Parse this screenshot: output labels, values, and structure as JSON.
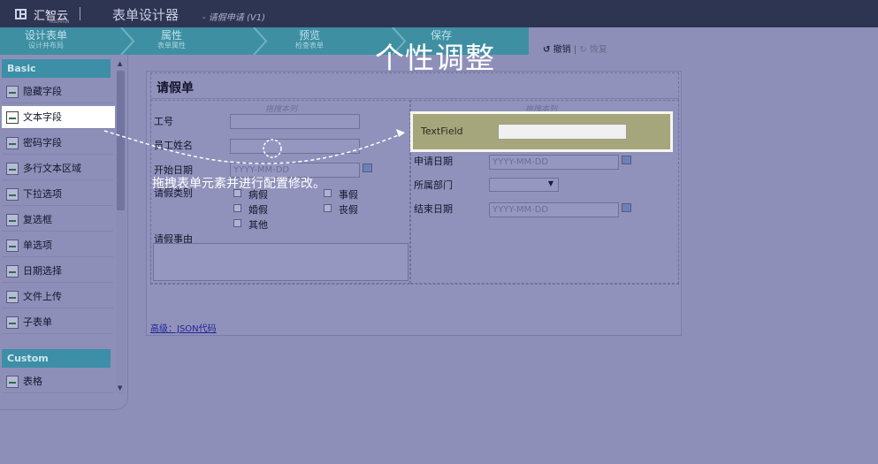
{
  "header": {
    "brand": "汇智云",
    "brand_sub": "HUIZHIYUN",
    "title": "表单设计器",
    "subtitle": "- 请假申请 (V1)"
  },
  "steps": [
    {
      "title": "设计表单",
      "sub": "设计并布局"
    },
    {
      "title": "属性",
      "sub": "表单属性"
    },
    {
      "title": "预览",
      "sub": "检查表单"
    },
    {
      "title": "保存",
      "sub": ""
    }
  ],
  "toolbar": {
    "undo_label": "撤销",
    "redo_label": "恢复"
  },
  "overlay": {
    "title": "个性调整",
    "hint": "拖拽表单元素并进行配置修改。"
  },
  "sidebar": {
    "basic_label": "Basic",
    "custom_label": "Custom",
    "basic_items": [
      "隐藏字段",
      "文本字段",
      "密码字段",
      "多行文本区域",
      "下拉选项",
      "复选框",
      "单选项",
      "日期选择",
      "文件上传",
      "子表单"
    ],
    "custom_items": [
      "表格"
    ]
  },
  "form": {
    "title": "请假单",
    "drag_hint": "拖拽本列",
    "left_fields": {
      "employee_id": "工号",
      "employee_name": "员工姓名",
      "start_date": "开始日期",
      "start_date_placeholder": "YYYY-MM-DD",
      "leave_type": "请假类别",
      "reason": "请假事由"
    },
    "leave_options": [
      "病假",
      "事假",
      "婚假",
      "丧假",
      "其他"
    ],
    "right_fields": {
      "apply_date": "申请日期",
      "department": "所属部门",
      "end_date": "结束日期",
      "date_placeholder": "YYYY-MM-DD"
    },
    "textfield_label": "TextField",
    "advanced_link": "高级：JSON代码"
  },
  "colors": {
    "topbar": "#2e3553",
    "stepbar": "#3f8fa3",
    "section": "#3c8fa7",
    "highlight": "#a6a67c"
  }
}
